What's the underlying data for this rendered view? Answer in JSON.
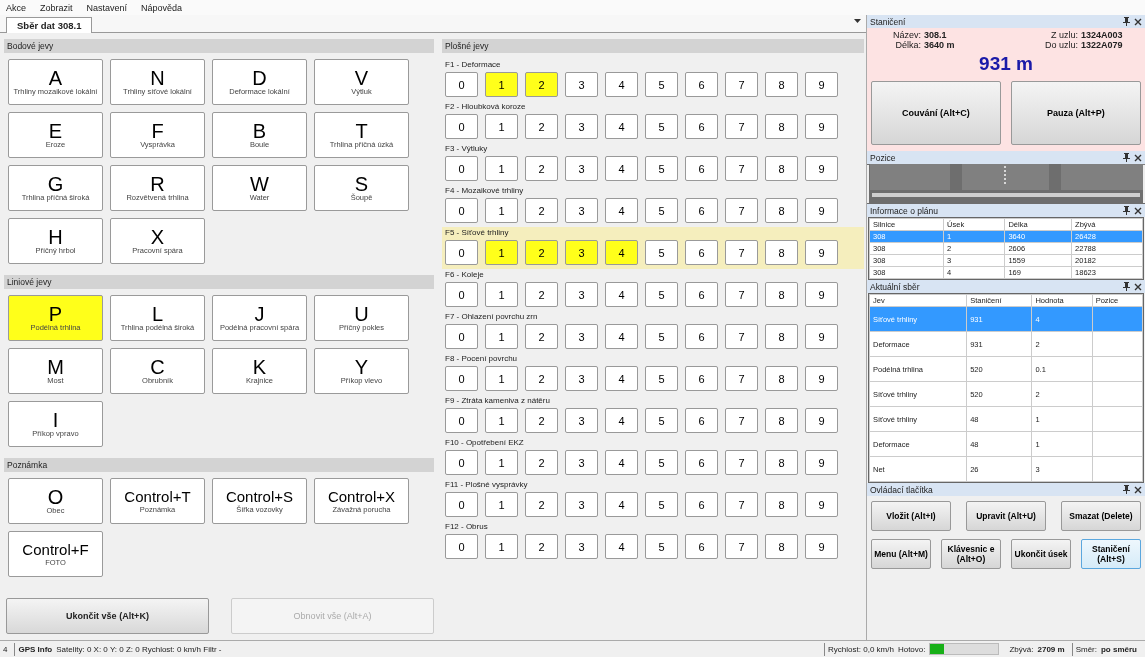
{
  "menu": [
    "Akce",
    "Zobrazit",
    "Nastavení",
    "Nápověda"
  ],
  "tabs": [
    {
      "label": "Sběr dat 308.1",
      "selected": true
    }
  ],
  "sections": [
    {
      "title": "Bodové jevy",
      "buttons": [
        {
          "kind": "letter",
          "key": "A",
          "label": "Trhliny mozaikové lokální",
          "selected": false
        },
        {
          "kind": "letter",
          "key": "N",
          "label": "Trhliny síťové lokální",
          "selected": false
        },
        {
          "kind": "letter",
          "key": "D",
          "label": "Deformace lokální",
          "selected": false
        },
        {
          "kind": "letter",
          "key": "V",
          "label": "Výtluk",
          "selected": false
        },
        {
          "kind": "letter",
          "key": "E",
          "label": "Eroze",
          "selected": false
        },
        {
          "kind": "letter",
          "key": "F",
          "label": "Vysprávka",
          "selected": false
        },
        {
          "kind": "letter",
          "key": "B",
          "label": "Boule",
          "selected": false
        },
        {
          "kind": "letter",
          "key": "T",
          "label": "Trhlina příčná úzká",
          "selected": false
        },
        {
          "kind": "letter",
          "key": "G",
          "label": "Trhlina příčná široká",
          "selected": false
        },
        {
          "kind": "letter",
          "key": "R",
          "label": "Rozvětvená trhlina",
          "selected": false
        },
        {
          "kind": "letter",
          "key": "W",
          "label": "Water",
          "selected": false
        },
        {
          "kind": "letter",
          "key": "S",
          "label": "Šoupě",
          "selected": false
        },
        {
          "kind": "letter",
          "key": "H",
          "label": "Příčný hrbol",
          "selected": false
        },
        {
          "kind": "letter",
          "key": "X",
          "label": "Pracovní spára",
          "selected": false
        }
      ]
    },
    {
      "title": "Liniové jevy",
      "buttons": [
        {
          "kind": "letter",
          "key": "P",
          "label": "Podélná trhlina",
          "selected": true
        },
        {
          "kind": "letter",
          "key": "L",
          "label": "Trhlina podélná široká",
          "selected": false
        },
        {
          "kind": "letter",
          "key": "J",
          "label": "Podélná pracovní spára",
          "selected": false
        },
        {
          "kind": "letter",
          "key": "U",
          "label": "Příčný pokles",
          "selected": false
        },
        {
          "kind": "letter",
          "key": "M",
          "label": "Most",
          "selected": false
        },
        {
          "kind": "letter",
          "key": "C",
          "label": "Obrubník",
          "selected": false
        },
        {
          "kind": "letter",
          "key": "K",
          "label": "Krajnice",
          "selected": false
        },
        {
          "kind": "letter",
          "key": "Y",
          "label": "Příkop vlevo",
          "selected": false
        },
        {
          "kind": "letter",
          "key": "I",
          "label": "Příkop vpravo",
          "selected": false
        }
      ]
    },
    {
      "title": "Poznámka",
      "buttons": [
        {
          "kind": "letter",
          "key": "O",
          "label": "Obec",
          "selected": false
        },
        {
          "kind": "shortcut",
          "key": "Control+T",
          "label": "Poznámka",
          "selected": false
        },
        {
          "kind": "shortcut",
          "key": "Control+S",
          "label": "Šířka vozovky",
          "selected": false
        },
        {
          "kind": "shortcut",
          "key": "Control+X",
          "label": "Závažná porucha",
          "selected": false
        },
        {
          "kind": "shortcut",
          "key": "Control+F",
          "label": "FOTO",
          "selected": false
        }
      ]
    }
  ],
  "bottom_buttons": [
    {
      "label": "Ukončit vše (Alt+K)",
      "disabled": false
    },
    {
      "label": "Obnovit vše (Alt+A)",
      "disabled": true
    }
  ],
  "area": {
    "title": "Plošné jevy",
    "rows": [
      {
        "label": "F1 - Deformace",
        "highlighted": false,
        "values": [
          {
            "label": "0",
            "selected": false
          },
          {
            "label": "1",
            "selected": true
          },
          {
            "label": "2",
            "selected": true
          },
          {
            "label": "3",
            "selected": false
          },
          {
            "label": "4",
            "selected": false
          },
          {
            "label": "5",
            "selected": false
          },
          {
            "label": "6",
            "selected": false
          },
          {
            "label": "7",
            "selected": false
          },
          {
            "label": "8",
            "selected": false
          },
          {
            "label": "9",
            "selected": false
          }
        ]
      },
      {
        "label": "F2 - Hloubková koroze",
        "highlighted": false,
        "values": [
          {
            "label": "0",
            "selected": false
          },
          {
            "label": "1",
            "selected": false
          },
          {
            "label": "2",
            "selected": false
          },
          {
            "label": "3",
            "selected": false
          },
          {
            "label": "4",
            "selected": false
          },
          {
            "label": "5",
            "selected": false
          },
          {
            "label": "6",
            "selected": false
          },
          {
            "label": "7",
            "selected": false
          },
          {
            "label": "8",
            "selected": false
          },
          {
            "label": "9",
            "selected": false
          }
        ]
      },
      {
        "label": "F3 - Výtluky",
        "highlighted": false,
        "values": [
          {
            "label": "0",
            "selected": false
          },
          {
            "label": "1",
            "selected": false
          },
          {
            "label": "2",
            "selected": false
          },
          {
            "label": "3",
            "selected": false
          },
          {
            "label": "4",
            "selected": false
          },
          {
            "label": "5",
            "selected": false
          },
          {
            "label": "6",
            "selected": false
          },
          {
            "label": "7",
            "selected": false
          },
          {
            "label": "8",
            "selected": false
          },
          {
            "label": "9",
            "selected": false
          }
        ]
      },
      {
        "label": "F4 - Mozaikové trhliny",
        "highlighted": false,
        "values": [
          {
            "label": "0",
            "selected": false
          },
          {
            "label": "1",
            "selected": false
          },
          {
            "label": "2",
            "selected": false
          },
          {
            "label": "3",
            "selected": false
          },
          {
            "label": "4",
            "selected": false
          },
          {
            "label": "5",
            "selected": false
          },
          {
            "label": "6",
            "selected": false
          },
          {
            "label": "7",
            "selected": false
          },
          {
            "label": "8",
            "selected": false
          },
          {
            "label": "9",
            "selected": false
          }
        ]
      },
      {
        "label": "F5 - Síťové trhliny",
        "highlighted": true,
        "values": [
          {
            "label": "0",
            "selected": false
          },
          {
            "label": "1",
            "selected": true
          },
          {
            "label": "2",
            "selected": true
          },
          {
            "label": "3",
            "selected": true
          },
          {
            "label": "4",
            "selected": true
          },
          {
            "label": "5",
            "selected": false
          },
          {
            "label": "6",
            "selected": false
          },
          {
            "label": "7",
            "selected": false
          },
          {
            "label": "8",
            "selected": false
          },
          {
            "label": "9",
            "selected": false
          }
        ]
      },
      {
        "label": "F6 - Koleje",
        "highlighted": false,
        "values": [
          {
            "label": "0",
            "selected": false
          },
          {
            "label": "1",
            "selected": false
          },
          {
            "label": "2",
            "selected": false
          },
          {
            "label": "3",
            "selected": false
          },
          {
            "label": "4",
            "selected": false
          },
          {
            "label": "5",
            "selected": false
          },
          {
            "label": "6",
            "selected": false
          },
          {
            "label": "7",
            "selected": false
          },
          {
            "label": "8",
            "selected": false
          },
          {
            "label": "9",
            "selected": false
          }
        ]
      },
      {
        "label": "F7 - Ohlazení povrchu zrn",
        "highlighted": false,
        "values": [
          {
            "label": "0",
            "selected": false
          },
          {
            "label": "1",
            "selected": false
          },
          {
            "label": "2",
            "selected": false
          },
          {
            "label": "3",
            "selected": false
          },
          {
            "label": "4",
            "selected": false
          },
          {
            "label": "5",
            "selected": false
          },
          {
            "label": "6",
            "selected": false
          },
          {
            "label": "7",
            "selected": false
          },
          {
            "label": "8",
            "selected": false
          },
          {
            "label": "9",
            "selected": false
          }
        ]
      },
      {
        "label": "F8 - Pocení povrchu",
        "highlighted": false,
        "values": [
          {
            "label": "0",
            "selected": false
          },
          {
            "label": "1",
            "selected": false
          },
          {
            "label": "2",
            "selected": false
          },
          {
            "label": "3",
            "selected": false
          },
          {
            "label": "4",
            "selected": false
          },
          {
            "label": "5",
            "selected": false
          },
          {
            "label": "6",
            "selected": false
          },
          {
            "label": "7",
            "selected": false
          },
          {
            "label": "8",
            "selected": false
          },
          {
            "label": "9",
            "selected": false
          }
        ]
      },
      {
        "label": "F9 - Ztráta kameniva z nátěru",
        "highlighted": false,
        "values": [
          {
            "label": "0",
            "selected": false
          },
          {
            "label": "1",
            "selected": false
          },
          {
            "label": "2",
            "selected": false
          },
          {
            "label": "3",
            "selected": false
          },
          {
            "label": "4",
            "selected": false
          },
          {
            "label": "5",
            "selected": false
          },
          {
            "label": "6",
            "selected": false
          },
          {
            "label": "7",
            "selected": false
          },
          {
            "label": "8",
            "selected": false
          },
          {
            "label": "9",
            "selected": false
          }
        ]
      },
      {
        "label": "F10 - Opotřebení EKZ",
        "highlighted": false,
        "values": [
          {
            "label": "0",
            "selected": false
          },
          {
            "label": "1",
            "selected": false
          },
          {
            "label": "2",
            "selected": false
          },
          {
            "label": "3",
            "selected": false
          },
          {
            "label": "4",
            "selected": false
          },
          {
            "label": "5",
            "selected": false
          },
          {
            "label": "6",
            "selected": false
          },
          {
            "label": "7",
            "selected": false
          },
          {
            "label": "8",
            "selected": false
          },
          {
            "label": "9",
            "selected": false
          }
        ]
      },
      {
        "label": "F11 - Plošné vysprávky",
        "highlighted": false,
        "values": [
          {
            "label": "0",
            "selected": false
          },
          {
            "label": "1",
            "selected": false
          },
          {
            "label": "2",
            "selected": false
          },
          {
            "label": "3",
            "selected": false
          },
          {
            "label": "4",
            "selected": false
          },
          {
            "label": "5",
            "selected": false
          },
          {
            "label": "6",
            "selected": false
          },
          {
            "label": "7",
            "selected": false
          },
          {
            "label": "8",
            "selected": false
          },
          {
            "label": "9",
            "selected": false
          }
        ]
      },
      {
        "label": "F12 - Obrus",
        "highlighted": false,
        "values": [
          {
            "label": "0",
            "selected": false
          },
          {
            "label": "1",
            "selected": false
          },
          {
            "label": "2",
            "selected": false
          },
          {
            "label": "3",
            "selected": false
          },
          {
            "label": "4",
            "selected": false
          },
          {
            "label": "5",
            "selected": false
          },
          {
            "label": "6",
            "selected": false
          },
          {
            "label": "7",
            "selected": false
          },
          {
            "label": "8",
            "selected": false
          },
          {
            "label": "9",
            "selected": false
          }
        ]
      }
    ]
  },
  "stationing": {
    "title": "Staničení",
    "name_label": "Název:",
    "name": "308.1",
    "length_label": "Délka:",
    "length": "3640 m",
    "from_label": "Z uzlu:",
    "from": "1324A003",
    "to_label": "Do uzlu:",
    "to": "1322A079",
    "value": "931 m",
    "buttons": [
      "Couvání (Alt+C)",
      "Pauza (Alt+P)"
    ]
  },
  "position": {
    "title": "Pozice"
  },
  "plan": {
    "title": "Informace o plánu",
    "columns": [
      "Silnice",
      "Úsek",
      "Délka",
      "Zbývá"
    ],
    "rows": [
      {
        "cells": [
          "308",
          "1",
          "3640",
          "26428"
        ],
        "selected": true
      },
      {
        "cells": [
          "308",
          "2",
          "2606",
          "22788"
        ],
        "selected": false
      },
      {
        "cells": [
          "308",
          "3",
          "1559",
          "20182"
        ],
        "selected": false
      },
      {
        "cells": [
          "308",
          "4",
          "169",
          "18623"
        ],
        "selected": false
      }
    ]
  },
  "current": {
    "title": "Aktuální sběr",
    "columns": [
      "Jev",
      "Staničení",
      "Hodnota",
      "Pozice"
    ],
    "rows": [
      {
        "cells": [
          "Síťové trhliny",
          "931",
          "4",
          ""
        ],
        "selected": true
      },
      {
        "cells": [
          "Deformace",
          "931",
          "2",
          ""
        ],
        "selected": false
      },
      {
        "cells": [
          "Podélná trhlina",
          "520",
          "0.1",
          ""
        ],
        "selected": false
      },
      {
        "cells": [
          "Síťové trhliny",
          "520",
          "2",
          ""
        ],
        "selected": false
      },
      {
        "cells": [
          "Síťové trhliny",
          "48",
          "1",
          ""
        ],
        "selected": false
      },
      {
        "cells": [
          "Deformace",
          "48",
          "1",
          ""
        ],
        "selected": false
      },
      {
        "cells": [
          "Net",
          "26",
          "3",
          ""
        ],
        "selected": false
      }
    ]
  },
  "controls": {
    "title": "Ovládací tlačítka",
    "edit_buttons": [
      {
        "label": "Vložit (Alt+I)",
        "focused": false
      },
      {
        "label": "Upravit (Alt+U)",
        "focused": false
      },
      {
        "label": "Smazat (Delete)",
        "focused": false
      }
    ],
    "nav_buttons": [
      {
        "label": "Menu (Alt+M)",
        "focused": false
      },
      {
        "label": "Klávesnic e (Alt+O)",
        "focused": false
      },
      {
        "label": "Ukončit úsek",
        "focused": false
      },
      {
        "label": "Staničení (Alt+S)",
        "focused": true
      }
    ]
  },
  "status": {
    "count": "4",
    "gps_title": "GPS Info",
    "gps": "Satelity: 0  X: 0  Y: 0  Z: 0  Rychlost: 0 km/h  Filtr -",
    "speed": "Rychlost: 0,0 km/h",
    "done_label": "Hotovo:",
    "level": 0.2,
    "remaining_label": "Zbývá:",
    "remaining": "2709 m",
    "direction_label": "Směr:",
    "direction": "po směru"
  }
}
